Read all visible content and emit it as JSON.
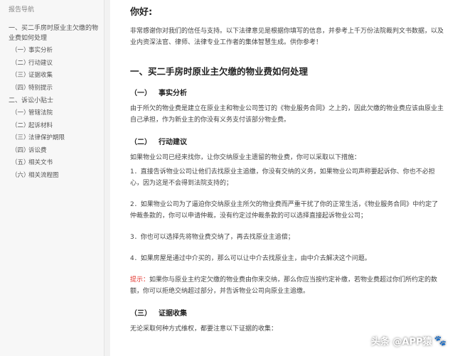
{
  "sidebar": {
    "title": "报告导航",
    "sections": [
      {
        "label": "一、买二手房时原业主欠缴的物业费如何处理",
        "items": [
          {
            "num": "（一）",
            "label": "事实分析"
          },
          {
            "num": "（二）",
            "label": "行动建议"
          },
          {
            "num": "（三）",
            "label": "证据收集"
          },
          {
            "num": "（四）",
            "label": "特别提示"
          }
        ]
      },
      {
        "label": "二、诉讼小贴士",
        "items": [
          {
            "num": "（一）",
            "label": "管辖法院"
          },
          {
            "num": "（二）",
            "label": "起诉材料"
          },
          {
            "num": "（三）",
            "label": "法律保护期限"
          },
          {
            "num": "（四）",
            "label": "诉讼费"
          },
          {
            "num": "（五）",
            "label": "相关文书"
          },
          {
            "num": "（六）",
            "label": "相关流程图"
          }
        ]
      }
    ]
  },
  "main": {
    "greeting": "你好:",
    "intro": "非常感谢你对我们的信任与支持。以下法律意见是根据你填写的信息，并参考上千万份法院裁判文书数据，以及业内资深法官、律师、法律专业工作者的集体智慧生成。供你参考！",
    "h1": "一、买二手房时原业主欠缴的物业费如何处理",
    "sec1": {
      "num": "（一）",
      "title": "事实分析",
      "text": "由于所欠的物业费是建立在原业主和物业公司签订的《物业服务合同》之上的，因此欠缴的物业费应该由原业主自己承担，作为新业主的你没有义务支付该部分物业费。"
    },
    "sec2": {
      "num": "（二）",
      "title": "行动建议",
      "p1": "如果物业公司已经来找你，让你交纳原业主遗留的物业费，你可以采取以下措施：",
      "p2": "1．直接告诉物业公司让他们去找原业主追缴，你没有交纳的义务，如果物业公司声称要起诉你、你也不必担心，因为这是不会得到法院支持的；",
      "p3": "2．如果物业公司为了逼迫你交纳原业主所欠的物业费而严重干扰了你的正常生活，《物业服务合同》中约定了仲裁条款的，你可以申请仲裁，没有约定过仲裁条款的可以选择直接起诉物业公司；",
      "p4": "3．你也可以选择先将物业费交纳了，再去找原业主追偿；",
      "p5": "4．如果房屋是通过中介买的，那么可以让中介去找原业主，由中介去解决这个问题。",
      "tip_label": "提示：",
      "tip_text": "如果你与原业主约定欠缴的物业费由你来交纳，那么你应当按约定补缴，若物业费超过你们所约定的数额，你可以拒绝交纳超过部分，并告诉物业公司向原业主追缴。"
    },
    "sec3": {
      "num": "（三）",
      "title": "证据收集",
      "text": "无论采取何种方式维权，都要注意以下证据的收集："
    }
  },
  "watermark": {
    "brand": "头条 @APP猿",
    "icon": "paw-icon"
  }
}
